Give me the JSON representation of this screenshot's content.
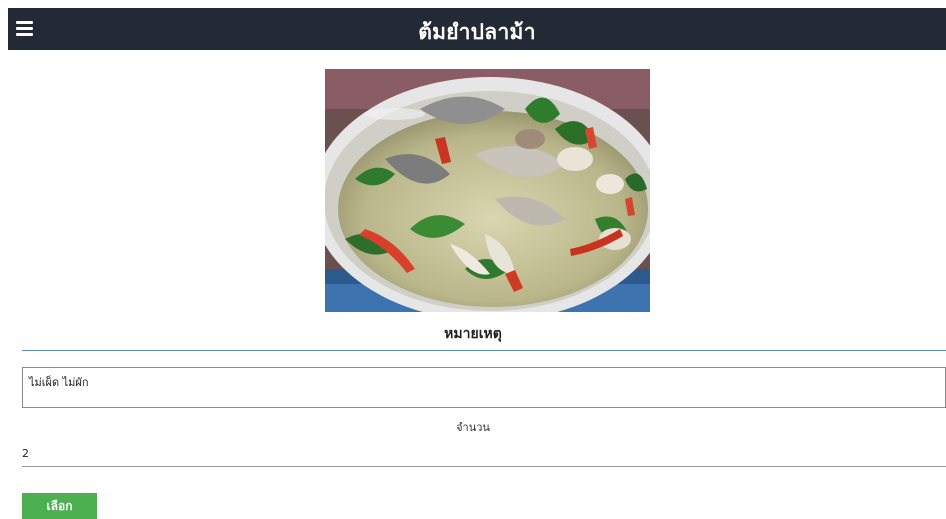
{
  "header": {
    "menu_icon": "hamburger-menu-icon",
    "title": "ต้มยำปลาม้า"
  },
  "dish": {
    "image_subject": "tom yum fish soup in a bowl"
  },
  "note": {
    "heading": "หมายเหตุ",
    "value": "ไม่เผ็ด ไม่ผัก"
  },
  "quantity": {
    "label": "จำนวน",
    "value": "2"
  },
  "actions": {
    "select_label": "เลือก"
  },
  "colors": {
    "header_bg": "#232a35",
    "divider": "#5b8fc7",
    "button_bg": "#4caf50"
  }
}
